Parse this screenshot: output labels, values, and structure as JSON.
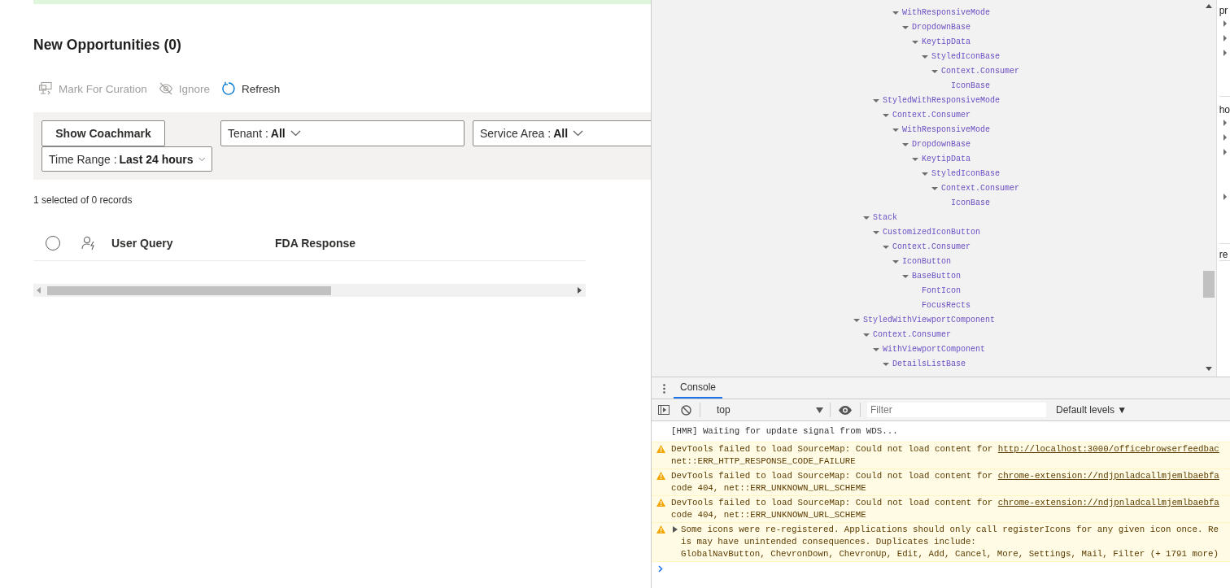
{
  "app": {
    "title": "New Opportunities (0)",
    "commands": [
      {
        "label": "Mark For Curation",
        "kind": "curate",
        "disabled": true
      },
      {
        "label": "Ignore",
        "kind": "ignore",
        "disabled": true
      },
      {
        "label": "Refresh",
        "kind": "refresh",
        "disabled": false
      }
    ],
    "filters": {
      "coachmark_button": "Show Coachmark",
      "dropdowns": [
        {
          "label": "Tenant :",
          "value": "All"
        },
        {
          "label": "Service Area :",
          "value": "All"
        },
        {
          "label": "Time Range :",
          "value": "Last 24 hours"
        }
      ]
    },
    "record_count": "1 selected of 0 records",
    "table": {
      "select_all_checked": false,
      "columns": [
        "User Query",
        "FDA Response"
      ]
    }
  },
  "components_tree": {
    "nodes": [
      {
        "children": [
          {
            "children": [
              {
                "children": [
                  {
                    "children": [
                      {
                        "label": "WithResponsiveMode",
                        "expanded": true,
                        "children": [
                          {
                            "label": "DropdownBase",
                            "expanded": true,
                            "children": [
                              {
                                "label": "KeytipData",
                                "expanded": true,
                                "children": [
                                  {
                                    "label": "StyledIconBase",
                                    "expanded": true,
                                    "children": [
                                      {
                                        "label": "Context.Consumer",
                                        "expanded": true,
                                        "children": [
                                          {
                                            "label": "IconBase"
                                          }
                                        ]
                                      }
                                    ]
                                  }
                                ]
                              }
                            ]
                          }
                        ]
                      }
                    ]
                  }
                ]
              },
              {
                "label": "StyledWithResponsiveMode",
                "expanded": true,
                "children": [
                  {
                    "label": "Context.Consumer",
                    "expanded": true,
                    "children": [
                      {
                        "label": "WithResponsiveMode",
                        "expanded": true,
                        "children": [
                          {
                            "label": "DropdownBase",
                            "expanded": true,
                            "children": [
                              {
                                "label": "KeytipData",
                                "expanded": true,
                                "children": [
                                  {
                                    "label": "StyledIconBase",
                                    "expanded": true,
                                    "children": [
                                      {
                                        "label": "Context.Consumer",
                                        "expanded": true,
                                        "children": [
                                          {
                                            "label": "IconBase"
                                          }
                                        ]
                                      }
                                    ]
                                  }
                                ]
                              }
                            ]
                          }
                        ]
                      }
                    ]
                  }
                ]
              }
            ]
          },
          {
            "label": "Stack",
            "expanded": true,
            "children": [
              {
                "label": "CustomizedIconButton",
                "expanded": true,
                "children": [
                  {
                    "label": "Context.Consumer",
                    "expanded": true,
                    "children": [
                      {
                        "label": "IconButton",
                        "expanded": true,
                        "children": [
                          {
                            "label": "BaseButton",
                            "expanded": true,
                            "children": [
                              {
                                "label": "FontIcon"
                              },
                              {
                                "label": "FocusRects"
                              }
                            ]
                          }
                        ]
                      }
                    ]
                  }
                ]
              }
            ]
          }
        ]
      },
      {
        "label": "StyledWithViewportComponent",
        "expanded": true,
        "children": [
          {
            "label": "Context.Consumer",
            "expanded": true,
            "children": [
              {
                "label": "WithViewportComponent",
                "expanded": true,
                "children": [
                  {
                    "label": "DetailsListBase",
                    "expanded": true
                  }
                ]
              }
            ]
          }
        ]
      }
    ]
  },
  "side_panel": {
    "sections": [
      {
        "label": "pr",
        "rows": [
          {
            "expanded": false
          },
          {
            "expanded": false
          },
          {
            "expanded": false
          }
        ]
      },
      {
        "label": "ho",
        "rows": [
          {
            "expanded": false
          },
          {
            "expanded": false
          },
          {
            "expanded": false
          },
          {
            "expanded": false
          }
        ]
      },
      {
        "label": "re"
      }
    ]
  },
  "console": {
    "tabs": [
      {
        "label": "Console",
        "selected": true
      }
    ],
    "context": "top",
    "filter_placeholder": "Filter",
    "levels": "Default levels ▼",
    "messages": [
      {
        "kind": "log",
        "text": "[HMR] Waiting for update signal from WDS..."
      },
      {
        "kind": "warning",
        "text": "DevTools failed to load SourceMap: Could not load content for ",
        "link": "http://localhost:3000/officebrowserfeedbac",
        "more": [
          "net::ERR_HTTP_RESPONSE_CODE_FAILURE"
        ]
      },
      {
        "kind": "warning",
        "text": "DevTools failed to load SourceMap: Could not load content for ",
        "link": "chrome-extension://ndjpnladcallmjemlbaebfa",
        "more": [
          "code 404, net::ERR_UNKNOWN_URL_SCHEME"
        ]
      },
      {
        "kind": "warning",
        "text": "DevTools failed to load SourceMap: Could not load content for ",
        "link": "chrome-extension://ndjpnladcallmjemlbaebfa",
        "more": [
          "code 404, net::ERR_UNKNOWN_URL_SCHEME"
        ]
      },
      {
        "kind": "warning",
        "expanded": false,
        "text": "Some icons were re-registered. Applications should only call registerIcons for any given icon once. Re",
        "more": [
          "is may have unintended consequences. Duplicates include:",
          "GlobalNavButton, ChevronDown, ChevronUp, Edit, Add, Cancel, More, Settings, Mail, Filter (+ 1791 more)"
        ]
      }
    ]
  }
}
